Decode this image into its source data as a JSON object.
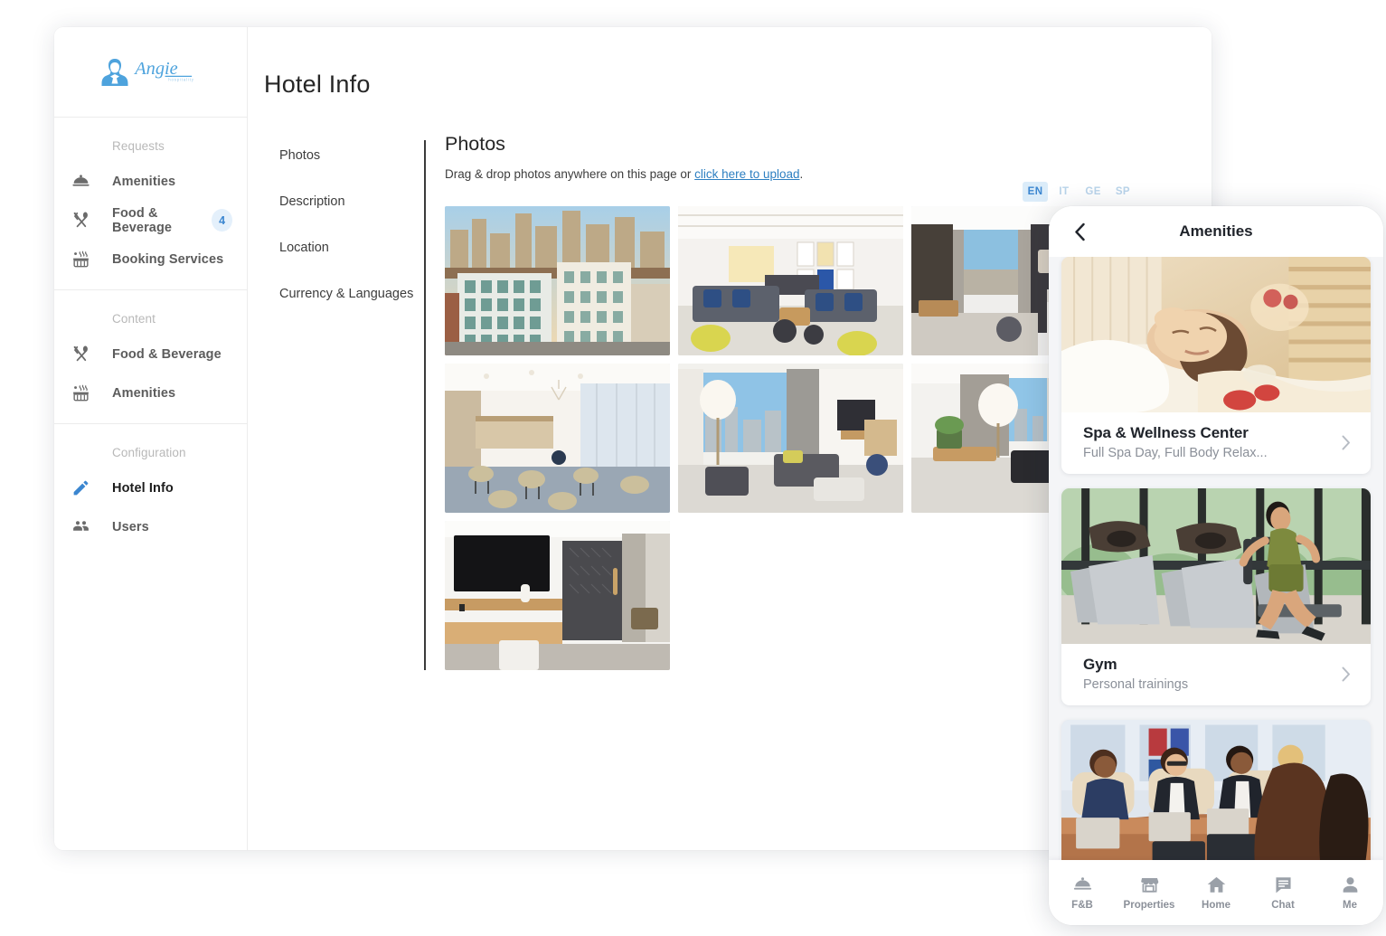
{
  "brand": {
    "name": "Angie",
    "tagline": "hospitality",
    "color": "#4ea3dd"
  },
  "sidebar": {
    "sections": [
      {
        "label": "Requests",
        "items": [
          {
            "label": "Amenities",
            "icon": "room-service-icon",
            "badge": null,
            "active": false
          },
          {
            "label": "Food & Beverage",
            "icon": "fork-spoon-icon",
            "badge": "4",
            "active": false
          },
          {
            "label": "Booking Services",
            "icon": "hot-tub-icon",
            "badge": null,
            "active": false
          }
        ]
      },
      {
        "label": "Content",
        "items": [
          {
            "label": "Food & Beverage",
            "icon": "fork-spoon-icon",
            "badge": null,
            "active": false
          },
          {
            "label": "Amenities",
            "icon": "hot-tub-icon",
            "badge": null,
            "active": false
          }
        ]
      },
      {
        "label": "Configuration",
        "items": [
          {
            "label": "Hotel Info",
            "icon": "pencil-icon",
            "badge": null,
            "active": true
          },
          {
            "label": "Users",
            "icon": "people-icon",
            "badge": null,
            "active": false
          }
        ]
      }
    ]
  },
  "main": {
    "page_title": "Hotel Info",
    "tabs": [
      {
        "label": "Photos",
        "selected": true
      },
      {
        "label": "Description",
        "selected": false
      },
      {
        "label": "Location",
        "selected": false
      },
      {
        "label": "Currency & Languages",
        "selected": false
      }
    ],
    "panel": {
      "heading": "Photos",
      "hint_prefix": "Drag & drop photos anywhere on this page or ",
      "hint_link": "click here to upload",
      "hint_suffix": "."
    },
    "languages": [
      {
        "code": "EN",
        "selected": true
      },
      {
        "code": "IT",
        "selected": false
      },
      {
        "code": "GE",
        "selected": false
      },
      {
        "code": "SP",
        "selected": false
      }
    ],
    "photos": [
      {
        "alt": "hotel-exterior-city-skyline"
      },
      {
        "alt": "hotel-lobby-lounge-seating"
      },
      {
        "alt": "guest-room-bed-city-view"
      },
      {
        "alt": "hotel-restaurant-dining-area"
      },
      {
        "alt": "suite-living-room-window-view"
      },
      {
        "alt": "suite-lounge-sofa-desk"
      },
      {
        "alt": "guest-room-tv-desk-wardrobe"
      }
    ]
  },
  "phone": {
    "back_icon": "chevron-left-icon",
    "title": "Amenities",
    "cards": [
      {
        "title": "Spa & Wellness Center",
        "subtitle": "Full Spa Day, Full Body Relax...",
        "image": "spa-massage-photo"
      },
      {
        "title": "Gym",
        "subtitle": "Personal trainings",
        "image": "gym-treadmill-photo"
      },
      {
        "title": "",
        "subtitle": "",
        "image": "meeting-room-photo"
      }
    ],
    "bottom_nav": [
      {
        "label": "F&B",
        "icon": "room-service-icon"
      },
      {
        "label": "Properties",
        "icon": "store-icon"
      },
      {
        "label": "Home",
        "icon": "home-icon"
      },
      {
        "label": "Chat",
        "icon": "chat-bubble-icon"
      },
      {
        "label": "Me",
        "icon": "person-icon"
      }
    ]
  }
}
